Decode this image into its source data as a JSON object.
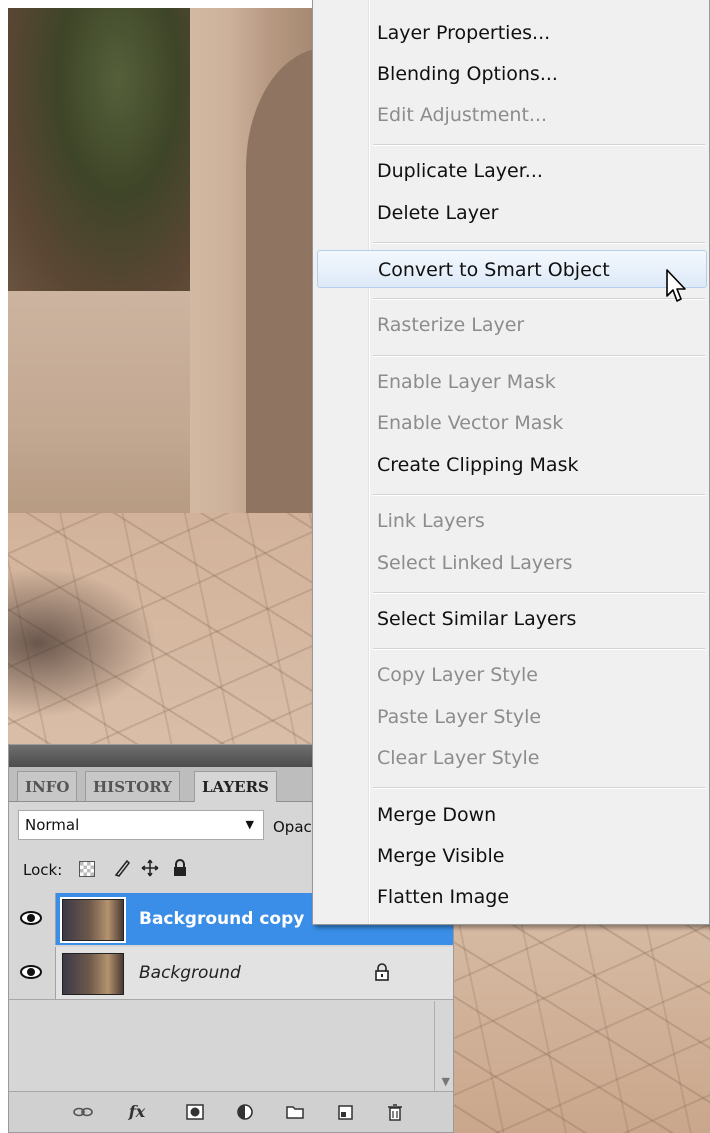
{
  "layers_panel": {
    "tabs": [
      "INFO",
      "HISTORY",
      "LAYERS"
    ],
    "active_tab": "LAYERS",
    "blend_mode": "Normal",
    "opacity_label": "Opac",
    "lock_label": "Lock:",
    "layers": [
      {
        "name": "Background copy",
        "selected": true,
        "visible": true,
        "locked": false
      },
      {
        "name": "Background",
        "selected": false,
        "visible": true,
        "locked": true
      }
    ],
    "bottom_icons": [
      "link-icon",
      "fx-icon",
      "mask-icon",
      "adjustment-icon",
      "folder-icon",
      "new-layer-icon",
      "trash-icon"
    ],
    "fx_label": "fx"
  },
  "context_menu": {
    "items": [
      {
        "label": "Layer Properties...",
        "disabled": false
      },
      {
        "label": "Blending Options...",
        "disabled": false
      },
      {
        "label": "Edit Adjustment...",
        "disabled": true
      },
      {
        "label": "Duplicate Layer...",
        "disabled": false
      },
      {
        "label": "Delete Layer",
        "disabled": false
      },
      {
        "label": "Convert to Smart Object",
        "disabled": false,
        "hovered": true
      },
      {
        "label": "Rasterize Layer",
        "disabled": true
      },
      {
        "label": "Enable Layer Mask",
        "disabled": true
      },
      {
        "label": "Enable Vector Mask",
        "disabled": true
      },
      {
        "label": "Create Clipping Mask",
        "disabled": false
      },
      {
        "label": "Link Layers",
        "disabled": true
      },
      {
        "label": "Select Linked Layers",
        "disabled": true
      },
      {
        "label": "Select Similar Layers",
        "disabled": false
      },
      {
        "label": "Copy Layer Style",
        "disabled": true
      },
      {
        "label": "Paste Layer Style",
        "disabled": true
      },
      {
        "label": "Clear Layer Style",
        "disabled": true
      },
      {
        "label": "Merge Down",
        "disabled": false
      },
      {
        "label": "Merge Visible",
        "disabled": false
      },
      {
        "label": "Flatten Image",
        "disabled": false
      }
    ]
  },
  "colors": {
    "selected_layer": "#3a8ee8",
    "menu_background": "#f0f0f0",
    "menu_hover": "#dde9f8",
    "disabled_text": "#8c8c8c"
  }
}
